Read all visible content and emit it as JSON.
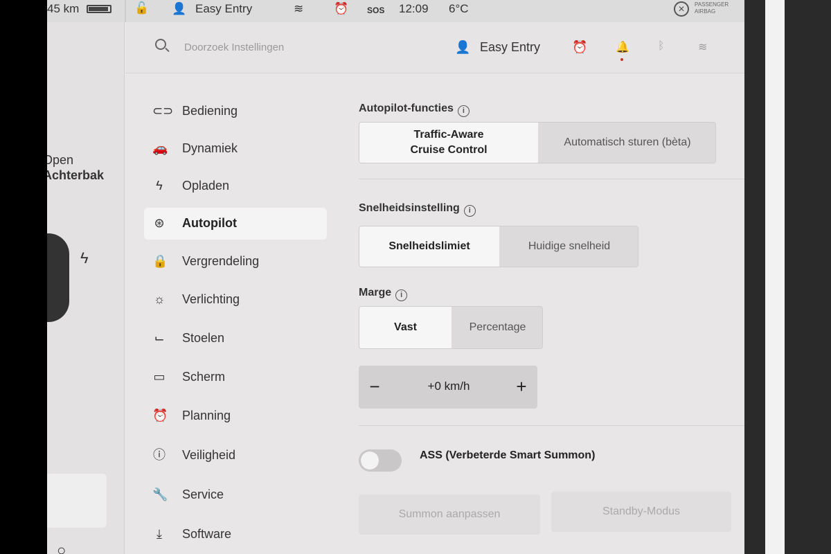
{
  "statusbar": {
    "range": "45 km",
    "profile": "Easy Entry",
    "sos": "SOS",
    "time": "12:09",
    "temperature": "6°C",
    "airbag_line1": "PASSENGER",
    "airbag_line2": "AIRBAG"
  },
  "carpanel": {
    "open_label": "Open",
    "trunk_label": "Achterbak"
  },
  "header": {
    "search_placeholder": "Doorzoek Instellingen",
    "profile": "Easy Entry"
  },
  "sidebar": {
    "items": [
      {
        "label": "Bediening",
        "icon": "toggle-icon"
      },
      {
        "label": "Dynamiek",
        "icon": "car-icon"
      },
      {
        "label": "Opladen",
        "icon": "bolt-icon"
      },
      {
        "label": "Autopilot",
        "icon": "steering-wheel-icon",
        "active": true
      },
      {
        "label": "Vergrendeling",
        "icon": "lock-icon"
      },
      {
        "label": "Verlichting",
        "icon": "sun-icon"
      },
      {
        "label": "Stoelen",
        "icon": "seat-icon"
      },
      {
        "label": "Scherm",
        "icon": "display-icon"
      },
      {
        "label": "Planning",
        "icon": "alarm-clock-icon"
      },
      {
        "label": "Veiligheid",
        "icon": "alert-icon"
      },
      {
        "label": "Service",
        "icon": "wrench-icon"
      },
      {
        "label": "Software",
        "icon": "download-icon"
      }
    ]
  },
  "autopilot": {
    "functions_title": "Autopilot-functies",
    "functions_options": [
      "Traffic-Aware\nCruise Control",
      "Automatisch sturen (bèta)"
    ],
    "functions_selected": 0,
    "speed_title": "Snelheidsinstelling",
    "speed_options": [
      "Snelheidslimiet",
      "Huidige snelheid"
    ],
    "speed_selected": 0,
    "margin_title": "Marge",
    "margin_options": [
      "Vast",
      "Percentage"
    ],
    "margin_selected": 0,
    "stepper_value": "+0 km/h",
    "stepper_minus": "−",
    "stepper_plus": "+",
    "ass_label": "ASS (Verbeterde Smart Summon)",
    "ass_enabled": false,
    "summon_button": "Summon aanpassen",
    "standby_button": "Standby-Modus"
  }
}
